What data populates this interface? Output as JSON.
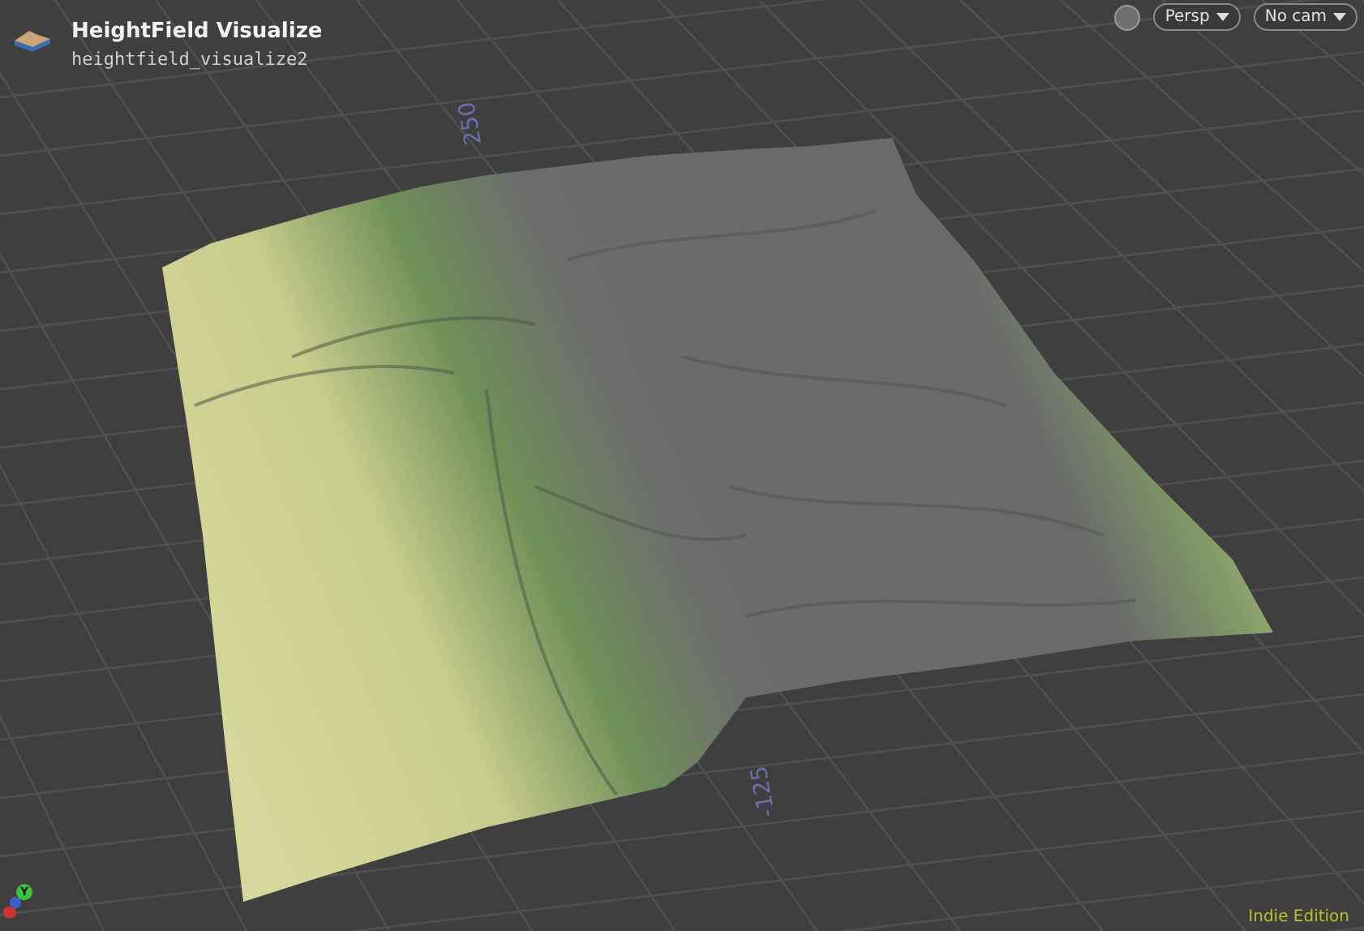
{
  "node": {
    "title": "HeightField Visualize",
    "path": "heightfield_visualize2"
  },
  "view_controls": [
    {
      "kind": "icon"
    },
    {
      "kind": "menu",
      "label": "Persp"
    },
    {
      "kind": "menu",
      "label": "No cam"
    }
  ],
  "grid_labels": [
    "250",
    "-125"
  ],
  "axis_gizmo": {
    "y_label": "Y"
  },
  "edition": "Indie Edition"
}
